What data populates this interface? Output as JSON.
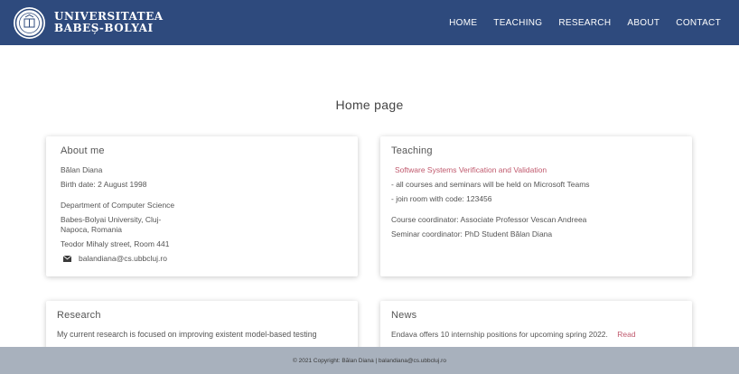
{
  "header": {
    "logo_line1": "UNIVERSITATEA",
    "logo_line2": "BABEȘ-BOLYAI",
    "nav": [
      "HOME",
      "TEACHING",
      "RESEARCH",
      "ABOUT",
      "CONTACT"
    ]
  },
  "page_title": "Home page",
  "about": {
    "title": "About me",
    "name": "Bălan Diana",
    "birth": "Birth date: 2 August 1998",
    "department": "Department of Computer Science",
    "university_line1": "Babes-Bolyai University, Cluj-",
    "university_line2": "Napoca, Romania",
    "address": "Teodor Mihaly street, Room 441",
    "email": "balandiana@cs.ubbcluj.ro",
    "email_icon": "envelope-icon"
  },
  "teaching": {
    "title": "Teaching",
    "course_link": "Software Systems Verification and Validation",
    "note1": "- all courses and seminars will be held on Microsoft Teams",
    "note2": "- join room with code: 123456",
    "coordinator": "Course coordinator: Associate Professor Vescan Andreea",
    "seminar": "Seminar coordinator: PhD Student Bălan Diana"
  },
  "research": {
    "title": "Research",
    "text": "My current research is focused on improving existent model-based testing"
  },
  "news": {
    "title": "News",
    "text": "Endava offers 10 internship positions for upcoming spring 2022.",
    "read_link": "Read"
  },
  "footer": {
    "text": "© 2021 Copyright: Bălan Diana | balandiana@cs.ubbcluj.ro"
  },
  "colors": {
    "navbar": "#2e4a7d",
    "link": "#c0596d",
    "footer": "#a8b1bd"
  }
}
